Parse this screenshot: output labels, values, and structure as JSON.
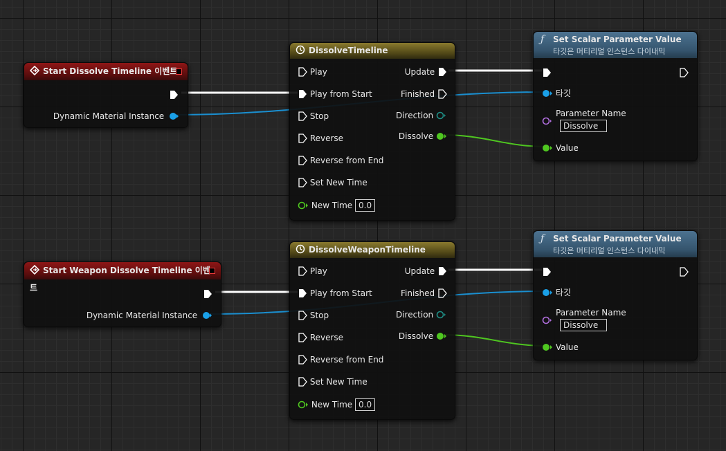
{
  "graph": {
    "event1": {
      "title": "Start Dissolve Timeline 이벤트",
      "output_label": "Dynamic Material Instance"
    },
    "event2": {
      "title": "Start Weapon Dissolve Timeline 이벤트",
      "output_label": "Dynamic Material Instance"
    },
    "timeline1": {
      "title": "DissolveTimeline",
      "inputs": [
        "Play",
        "Play from Start",
        "Stop",
        "Reverse",
        "Reverse from End",
        "Set New Time"
      ],
      "new_time_label": "New Time",
      "new_time_value": "0.0",
      "outputs": [
        "Update",
        "Finished",
        "Direction",
        "Dissolve"
      ]
    },
    "timeline2": {
      "title": "DissolveWeaponTimeline",
      "inputs": [
        "Play",
        "Play from Start",
        "Stop",
        "Reverse",
        "Reverse from End",
        "Set New Time"
      ],
      "new_time_label": "New Time",
      "new_time_value": "0.0",
      "outputs": [
        "Update",
        "Finished",
        "Direction",
        "Dissolve"
      ]
    },
    "func1": {
      "title": "Set Scalar Parameter Value",
      "subtitle": "타깃은 머티리얼 인스턴스 다이내믹",
      "target_label": "타깃",
      "param_label": "Parameter Name",
      "param_value": "Dissolve",
      "value_label": "Value"
    },
    "func2": {
      "title": "Set Scalar Parameter Value",
      "subtitle": "타깃은 머티리얼 인스턴스 다이내믹",
      "target_label": "타깃",
      "param_label": "Parameter Name",
      "param_value": "Dissolve",
      "value_label": "Value"
    }
  },
  "icons": {
    "event": "event-diamond-icon",
    "timeline": "clock-icon",
    "function": "function-f-icon"
  },
  "colors": {
    "exec": "#ffffff",
    "object_pin": "#1aa0e8",
    "float_pin": "#4fc720",
    "name_pin": "#b26fe0",
    "direction_pin": "#1e8f86",
    "event_header": "#8e1616",
    "timeline_header": "#8a7a2e",
    "function_header": "#4c7290"
  }
}
